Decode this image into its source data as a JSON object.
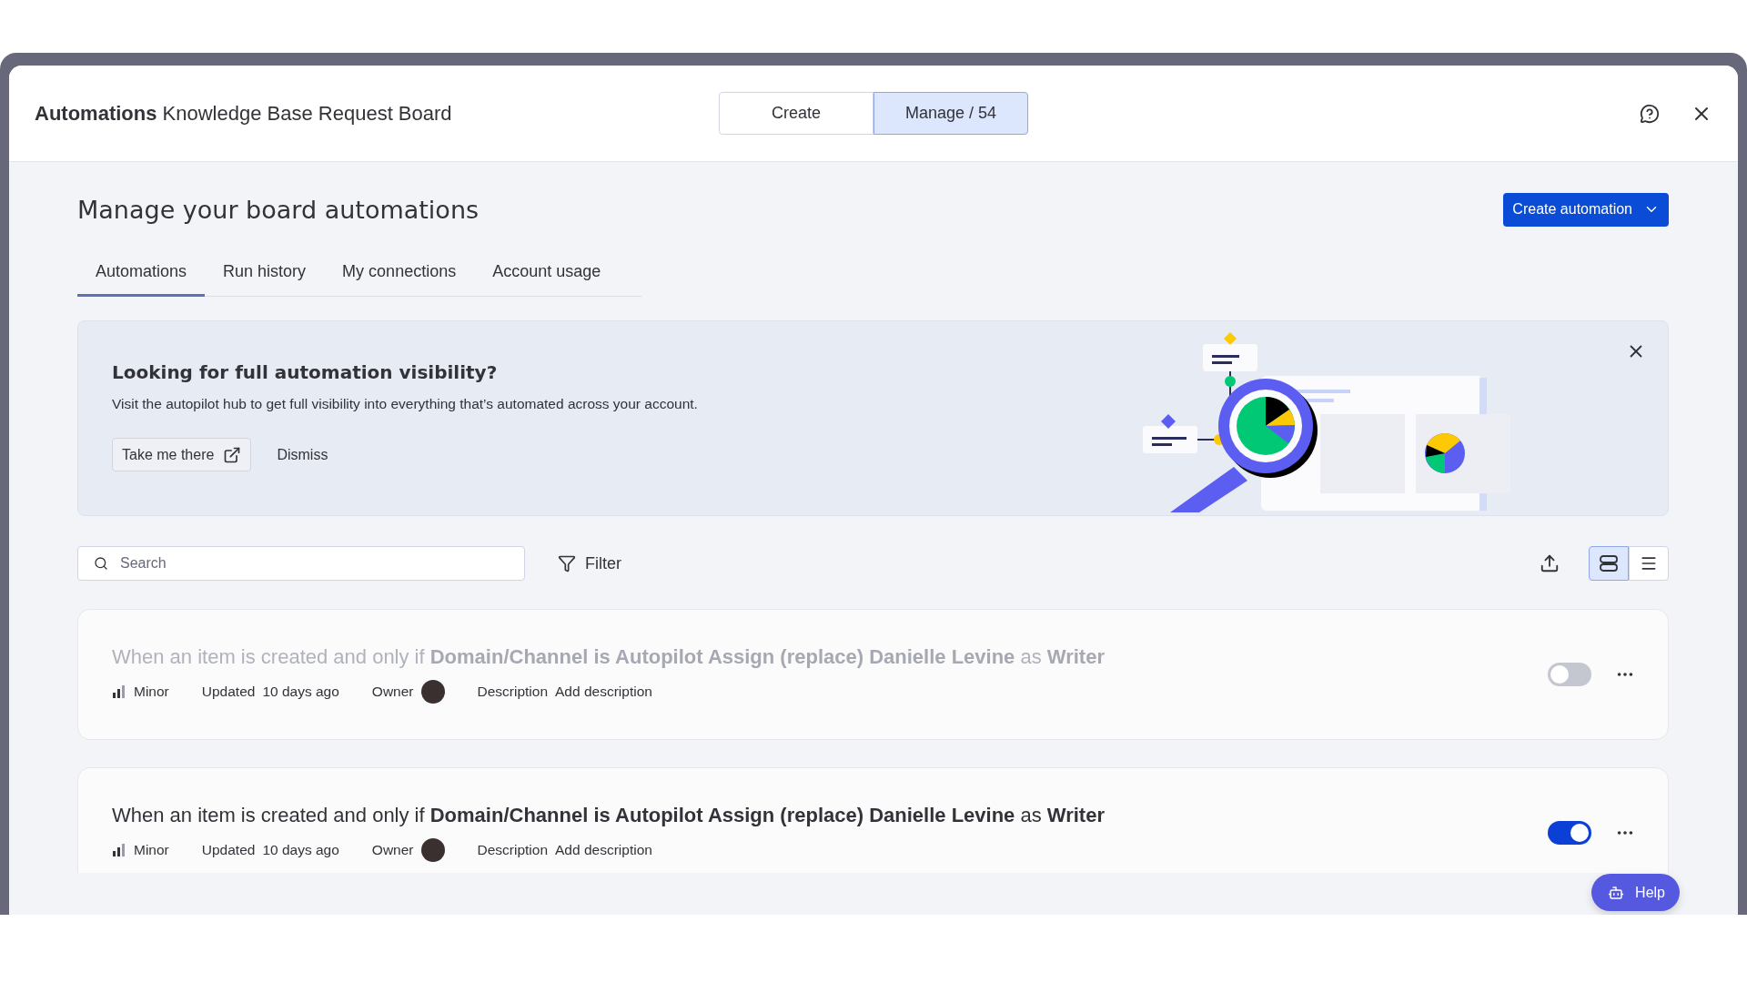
{
  "modal": {
    "title_bold": "Automations",
    "title": "Knowledge Base Request Board",
    "mode_tabs": [
      {
        "label": "Create",
        "selected": false
      },
      {
        "label": "Manage / 54",
        "selected": true
      }
    ]
  },
  "heading": "Manage your board automations",
  "create_button": "Create automation",
  "tabs": [
    {
      "label": "Automations",
      "selected": true
    },
    {
      "label": "Run history",
      "selected": false
    },
    {
      "label": "My connections",
      "selected": false
    },
    {
      "label": "Account usage",
      "selected": false
    }
  ],
  "banner": {
    "title": "Looking for full automation visibility?",
    "text": "Visit the autopilot hub to get full visibility into everything that’s automated across your account.",
    "primary_button": "Take me there",
    "secondary_button": "Dismiss"
  },
  "search": {
    "placeholder": "Search"
  },
  "filter": "Filter",
  "view_modes": [
    {
      "kind": "cards",
      "selected": true
    },
    {
      "kind": "list",
      "selected": false
    }
  ],
  "automations": [
    {
      "rule": "When an item is created and only if **Domain/Channel is Autopilot Assign (replace) Danielle Levine** as **Writer**",
      "enabled": false,
      "priority": "Minor",
      "updated_label": "Updated",
      "updated": "10 days ago",
      "owner_label": "Owner",
      "description_label": "Description",
      "description": "Add description"
    },
    {
      "rule": "When an item is created and only if **Domain/Channel is Autopilot Assign (replace) Danielle Levine** as **Writer**",
      "enabled": true,
      "priority": "Minor",
      "updated_label": "Updated",
      "updated": "10 days ago",
      "owner_label": "Owner",
      "description_label": "Description",
      "description": "Add description"
    }
  ],
  "help_button": "Help"
}
